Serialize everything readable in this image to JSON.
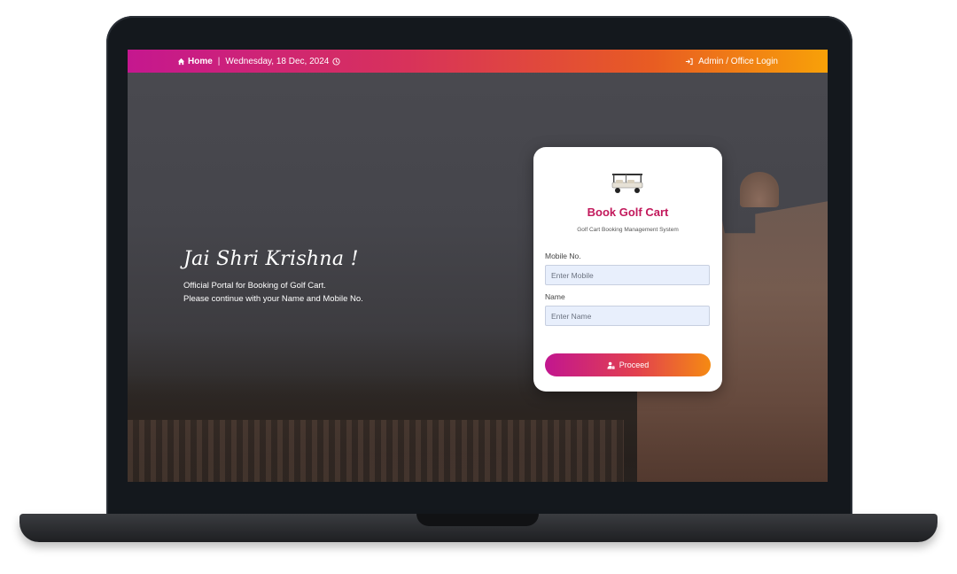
{
  "topbar": {
    "home_label": "Home",
    "separator": "|",
    "date_text": "Wednesday, 18 Dec, 2024",
    "login_label": "Admin / Office Login",
    "colors": {
      "gradient_start": "#c5178f",
      "gradient_end": "#f8a108"
    }
  },
  "hero": {
    "greeting": "Jai Shri Krishna !",
    "line1": "Official Portal for Booking of Golf Cart.",
    "line2": "Please continue with your Name and Mobile No."
  },
  "card": {
    "image_icon": "golf-cart-image",
    "title": "Book Golf Cart",
    "subtitle": "Golf Cart Booking Management System",
    "mobile_label": "Mobile No.",
    "mobile_placeholder": "Enter Mobile",
    "mobile_value": "",
    "name_label": "Name",
    "name_placeholder": "Enter Name",
    "name_value": "",
    "proceed_label": "Proceed",
    "proceed_icon": "user-lock-icon",
    "title_color": "#c2185b"
  }
}
